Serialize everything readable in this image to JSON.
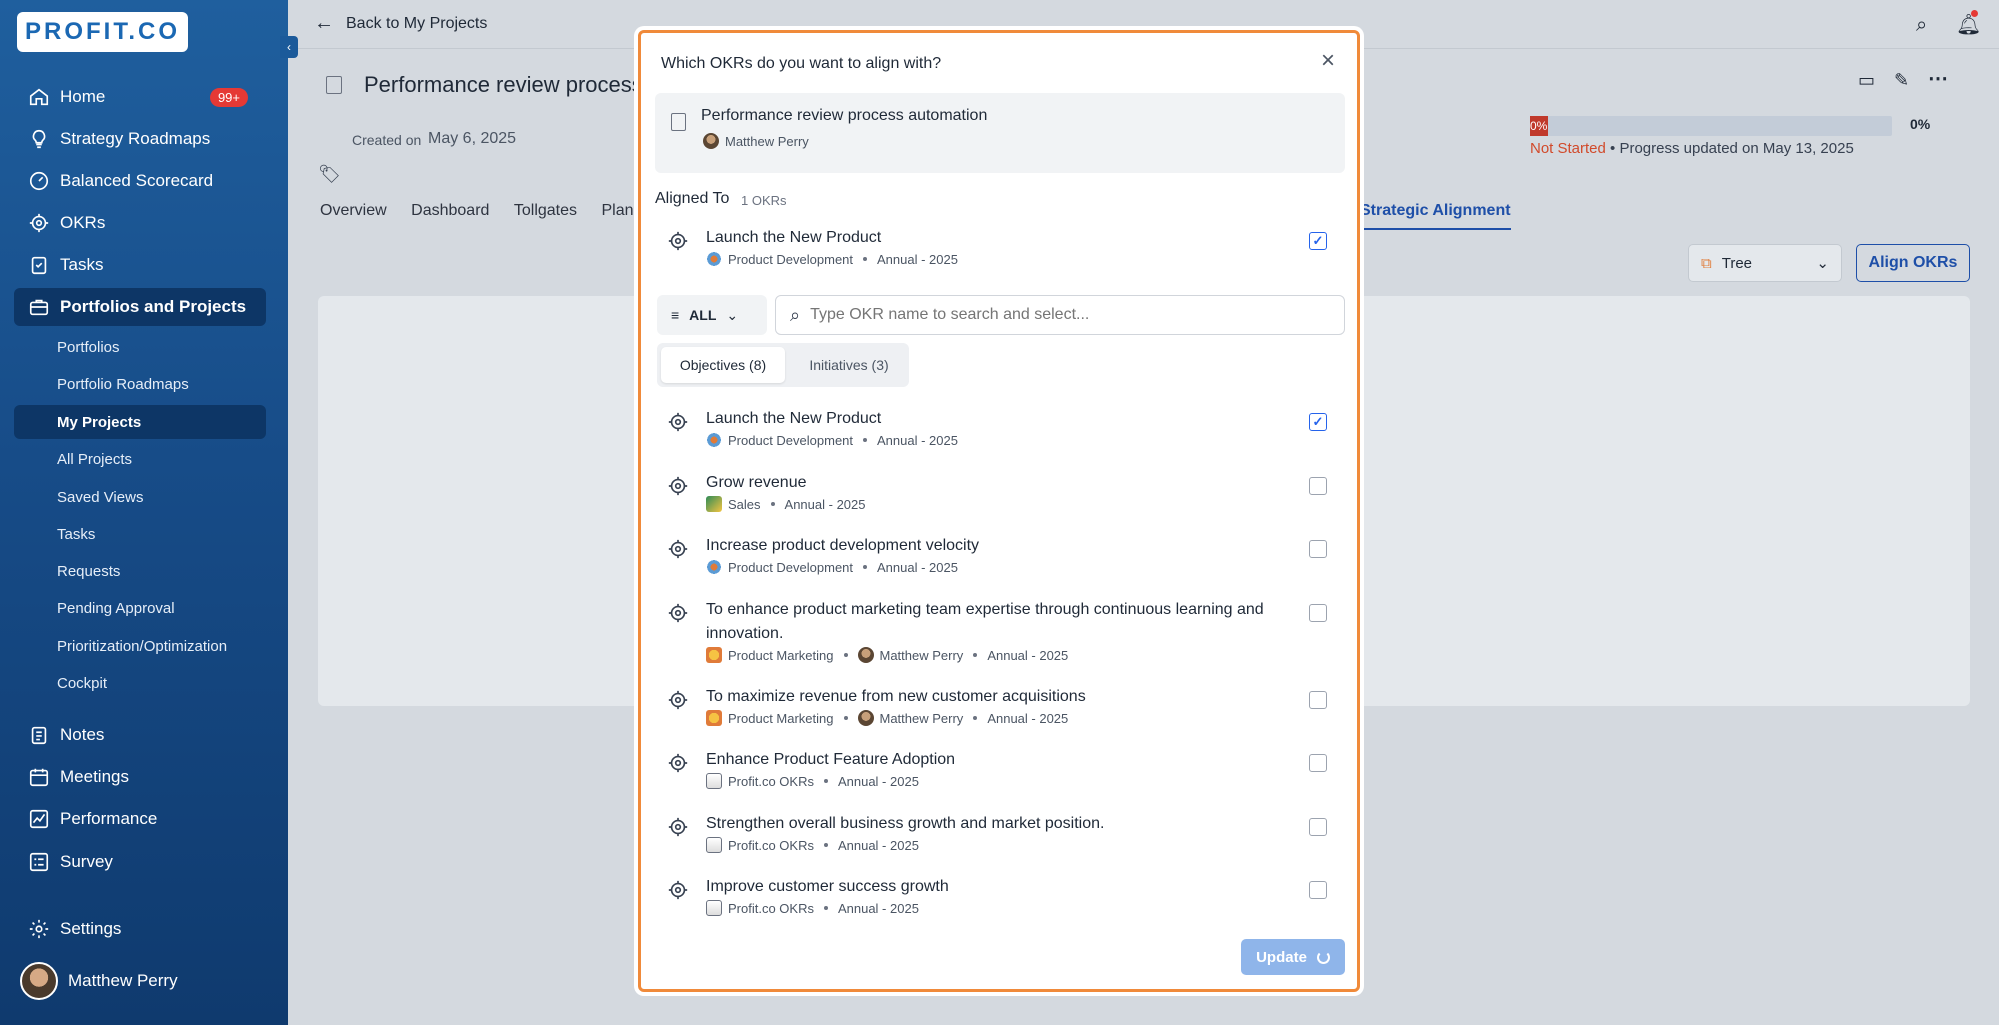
{
  "logo": "PROFIT.CO",
  "sidebar": {
    "home": "Home",
    "home_badge": "99+",
    "strategy": "Strategy Roadmaps",
    "scorecard": "Balanced Scorecard",
    "okrs": "OKRs",
    "tasks": "Tasks",
    "portfolios_projects": "Portfolios and Projects",
    "sub": [
      "Portfolios",
      "Portfolio Roadmaps",
      "My Projects",
      "All Projects",
      "Saved Views",
      "Tasks",
      "Requests",
      "Pending Approval",
      "Prioritization/Optimization",
      "Cockpit"
    ],
    "notes": "Notes",
    "meetings": "Meetings",
    "performance": "Performance",
    "survey": "Survey",
    "settings": "Settings",
    "user": "Matthew Perry"
  },
  "header": {
    "back": "Back to My Projects"
  },
  "project": {
    "title": "Performance review process automation",
    "created_label": "Created on",
    "created_date": "May 6, 2025",
    "progress_pct_bar": "0%",
    "progress_pct": "0%",
    "status": "Not Started",
    "progress_note": "• Progress updated on May 13, 2025",
    "progress": 0,
    "tabs": [
      "Overview",
      "Dashboard",
      "Tollgates",
      "Plan"
    ],
    "active_tab": "Strategic Alignment",
    "view_select": "Tree",
    "align_button": "Align OKRs"
  },
  "modal": {
    "question": "Which OKRs do you want to align with?",
    "source_title": "Performance review process automation",
    "source_owner": "Matthew Perry",
    "aligned_label": "Aligned To",
    "aligned_count": "1 OKRs",
    "aligned": {
      "title": "Launch the New Product",
      "team": "Product Development",
      "period": "Annual - 2025"
    },
    "filter": "ALL",
    "search_placeholder": "Type OKR name to search and select...",
    "tab_objectives": "Objectives (8)",
    "tab_initiatives": "Initiatives (3)",
    "items": [
      {
        "title": "Launch the New Product",
        "team": "Product Development",
        "owner": "",
        "period": "Annual - 2025",
        "checked": true
      },
      {
        "title": "Grow revenue",
        "team": "Sales",
        "owner": "",
        "period": "Annual - 2025",
        "checked": false
      },
      {
        "title": "Increase product development velocity",
        "team": "Product Development",
        "owner": "",
        "period": "Annual - 2025",
        "checked": false
      },
      {
        "title": "To enhance product marketing team expertise through continuous learning and innovation.",
        "team": "Product Marketing",
        "owner": "Matthew Perry",
        "period": "Annual - 2025",
        "checked": false
      },
      {
        "title": "To maximize revenue from new customer acquisitions",
        "team": "Product Marketing",
        "owner": "Matthew Perry",
        "period": "Annual - 2025",
        "checked": false
      },
      {
        "title": "Enhance Product Feature Adoption",
        "team": "Profit.co OKRs",
        "owner": "",
        "period": "Annual - 2025",
        "checked": false
      },
      {
        "title": "Strengthen overall business growth and market position.",
        "team": "Profit.co OKRs",
        "owner": "",
        "period": "Annual - 2025",
        "checked": false
      },
      {
        "title": "Improve customer success growth",
        "team": "Profit.co OKRs",
        "owner": "",
        "period": "Annual - 2025",
        "checked": false
      }
    ],
    "update": "Update"
  },
  "colors": {
    "brand": "#1b68b3",
    "accent": "#2563eb",
    "notstarted": "#d14a2b",
    "modal_border": "#f08a3a"
  }
}
